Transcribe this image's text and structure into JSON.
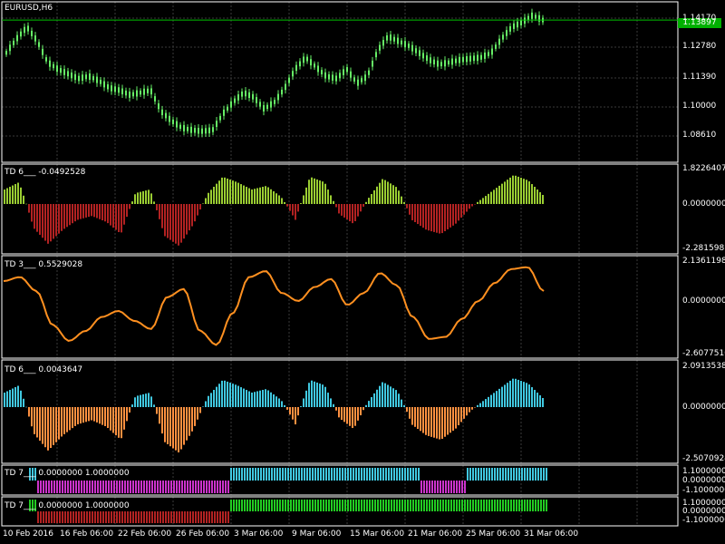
{
  "symbol_label": "EURUSD,H6",
  "colors": {
    "background": "#000000",
    "grid": "#3a3a3a",
    "axis": "#ffffff",
    "price_line": "#00c000",
    "candle": "#66ee66",
    "td6_pos": "#9acd32",
    "td6_neg": "#b22222",
    "td3_line": "#ff9020",
    "td6b_pos": "#40c8e0",
    "td6b_neg": "#ff9040",
    "td7a_pos": "#40c8e0",
    "td7a_neg": "#cc33cc",
    "td7b_pos": "#22cc22",
    "td7b_neg": "#b22222"
  },
  "main": {
    "current_price": "1.13897",
    "price_labels": [
      "1.14170",
      "1.12780",
      "1.11390",
      "1.10000",
      "1.08610"
    ]
  },
  "panels": [
    {
      "id": "td6a",
      "title": "TD 6___  -0.0492528",
      "axis": [
        "1.8226407",
        "0.0000000",
        "-2.2815987"
      ]
    },
    {
      "id": "td3",
      "title": "TD 3___  0.5529028",
      "axis": [
        "2.1361198",
        "0.0000000",
        "-2.6077510"
      ]
    },
    {
      "id": "td6b",
      "title": "TD 6___  0.0043647",
      "axis": [
        "2.0913538",
        "0.0000000",
        "-2.5070924"
      ]
    },
    {
      "id": "td7a",
      "title": "TD 7___  0.0000000 1.0000000",
      "axis": [
        "1.1000000",
        "0.0000000",
        "-1.1000000"
      ]
    },
    {
      "id": "td7b",
      "title": "TD 7___  0.0000000 1.0000000",
      "axis": [
        "1.1000000",
        "0.0000000",
        "-1.1000000"
      ]
    }
  ],
  "time_axis": [
    "10 Feb 2016",
    "16 Feb 06:00",
    "22 Feb 06:00",
    "26 Feb 06:00",
    "3 Mar 06:00",
    "9 Mar 06:00",
    "15 Mar 06:00",
    "21 Mar 06:00",
    "25 Mar 06:00",
    "31 Mar 06:00"
  ],
  "chart_data": {
    "type": "line",
    "price": {
      "x_labels": [
        "10 Feb 2016",
        "16 Feb 06:00",
        "22 Feb 06:00",
        "26 Feb 06:00",
        "3 Mar 06:00",
        "9 Mar 06:00",
        "15 Mar 06:00",
        "21 Mar 06:00",
        "25 Mar 06:00",
        "31 Mar 06:00"
      ],
      "values": [
        1.125,
        1.131,
        1.136,
        1.13,
        1.121,
        1.118,
        1.116,
        1.114,
        1.115,
        1.113,
        1.11,
        1.109,
        1.107,
        1.108,
        1.109,
        1.1,
        1.096,
        1.093,
        1.092,
        1.0915,
        1.092,
        1.099,
        1.104,
        1.108,
        1.106,
        1.101,
        1.104,
        1.11,
        1.118,
        1.123,
        1.119,
        1.115,
        1.114,
        1.118,
        1.112,
        1.115,
        1.126,
        1.132,
        1.13,
        1.128,
        1.125,
        1.122,
        1.12,
        1.121,
        1.122,
        1.1225,
        1.123,
        1.125,
        1.131,
        1.136,
        1.138,
        1.141,
        1.139
      ]
    },
    "td6a": [
      0.8,
      1.2,
      -1.2,
      -2.0,
      -1.3,
      -0.8,
      -0.6,
      -0.9,
      -1.5,
      0.6,
      0.8,
      -1.6,
      -2.1,
      -1.0,
      0.6,
      1.5,
      1.2,
      0.8,
      1.0,
      0.4,
      -0.8,
      1.5,
      1.2,
      -0.5,
      -1.0,
      0.3,
      1.4,
      0.9,
      -0.8,
      -1.3,
      -1.5,
      -1.0,
      -0.2,
      0.4,
      1.0,
      1.6,
      1.3,
      0.5
    ],
    "td3": [
      1.0,
      1.2,
      0.5,
      -1.2,
      -2.0,
      -1.5,
      -0.8,
      -0.5,
      -1.0,
      -1.4,
      0.2,
      0.6,
      -1.5,
      -2.2,
      -0.6,
      1.2,
      1.5,
      0.4,
      0.0,
      0.7,
      1.1,
      -0.2,
      0.4,
      1.4,
      0.8,
      -0.8,
      -1.9,
      -1.8,
      -0.9,
      0.0,
      0.9,
      1.6,
      1.7,
      0.5
    ],
    "td6b": [
      0.8,
      1.2,
      -1.2,
      -2.0,
      -1.3,
      -0.8,
      -0.6,
      -0.9,
      -1.5,
      0.6,
      0.8,
      -1.6,
      -2.1,
      -1.0,
      0.6,
      1.5,
      1.2,
      0.8,
      1.0,
      0.4,
      -0.8,
      1.5,
      1.2,
      -0.5,
      -1.0,
      0.3,
      1.4,
      0.9,
      -0.8,
      -1.3,
      -1.5,
      -1.0,
      -0.2,
      0.4,
      1.0,
      1.6,
      1.3,
      0.5
    ],
    "td7a": [
      1,
      -1,
      -1,
      -1,
      -1,
      -1,
      -1,
      -1,
      -1,
      -1,
      -1,
      -1,
      -1,
      -1,
      1,
      1,
      1,
      1,
      1,
      1,
      1,
      1,
      1,
      1,
      1,
      1,
      1,
      -1,
      -1,
      -1,
      1,
      1,
      1,
      1,
      1,
      1
    ],
    "td7b": [
      1,
      -1,
      -1,
      -1,
      -1,
      -1,
      -1,
      -1,
      -1,
      -1,
      -1,
      -1,
      -1,
      -1,
      1,
      1,
      1,
      1,
      1,
      1,
      1,
      1,
      1,
      1,
      1,
      1,
      1,
      1,
      1,
      1,
      1,
      1,
      1,
      1,
      1,
      1
    ]
  }
}
